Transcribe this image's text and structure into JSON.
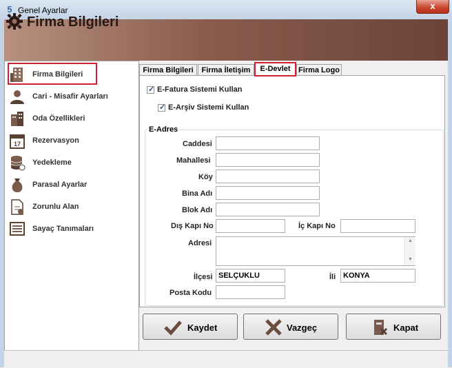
{
  "window": {
    "title": "Genel Ayarlar",
    "close": "x"
  },
  "header": {
    "title": "Firma Bilgileri"
  },
  "sidebar": {
    "items": [
      {
        "label": "Firma Bilgileri",
        "icon": "building-icon"
      },
      {
        "label": "Cari - Misafir Ayarları",
        "icon": "user-icon"
      },
      {
        "label": "Oda Özellikleri",
        "icon": "hotel-icon"
      },
      {
        "label": "Rezervasyon",
        "icon": "calendar-icon"
      },
      {
        "label": "Yedekleme",
        "icon": "database-icon"
      },
      {
        "label": "Parasal Ayarlar",
        "icon": "money-bag-icon"
      },
      {
        "label": "Zorunlu Alan",
        "icon": "document-icon"
      },
      {
        "label": "Sayaç Tanımaları",
        "icon": "counter-icon"
      }
    ]
  },
  "tabs": [
    {
      "label": "Firma Bilgileri"
    },
    {
      "label": "Firma İletişim"
    },
    {
      "label": "E-Devlet"
    },
    {
      "label": "Firma Logo"
    }
  ],
  "edevlet": {
    "efatura_label": "E-Fatura Sistemi Kullan",
    "earsiv_label": "E-Arşiv Sistemi Kullan",
    "group_title": "E-Adres",
    "fields": {
      "caddesi": {
        "label": "Caddesi",
        "value": ""
      },
      "mahallesi": {
        "label": "Mahallesi",
        "value": ""
      },
      "koy": {
        "label": "Köy",
        "value": ""
      },
      "bina_adi": {
        "label": "Bina Adı",
        "value": ""
      },
      "blok_adi": {
        "label": "Blok Adı",
        "value": ""
      },
      "dis_kapi": {
        "label": "Dış Kapı No",
        "value": ""
      },
      "ic_kapi": {
        "label": "İç Kapı No",
        "value": ""
      },
      "adresi": {
        "label": "Adresi",
        "value": ""
      },
      "ilcesi": {
        "label": "İlçesi",
        "value": "SELÇUKLU"
      },
      "ili": {
        "label": "İli",
        "value": "KONYA"
      },
      "posta_kodu": {
        "label": "Posta Kodu",
        "value": ""
      }
    }
  },
  "buttons": {
    "save": "Kaydet",
    "cancel": "Vazgeç",
    "close": "Kapat"
  },
  "colors": {
    "highlight": "#d21e2d",
    "header_brown": "#8a5d4e"
  }
}
